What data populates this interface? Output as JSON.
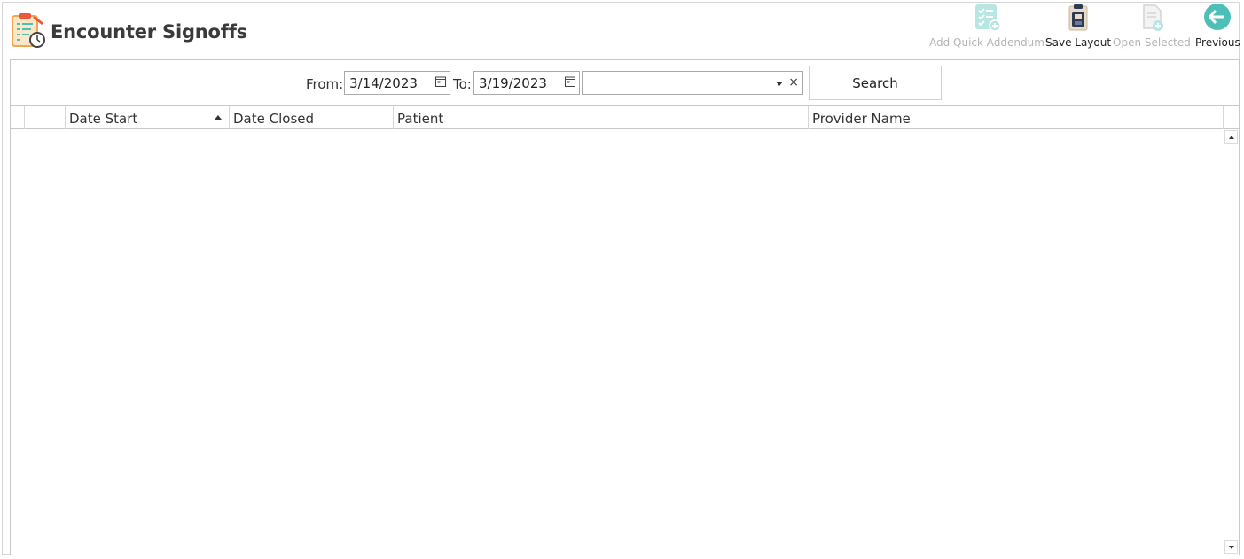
{
  "header": {
    "title": "Encounter Signoffs",
    "app_icon": "clipboard-clock-icon"
  },
  "toolbar": {
    "add_quick_addendum": {
      "label": "Add Quick Addendum",
      "icon": "checklist-add-icon",
      "enabled": false
    },
    "save_layout": {
      "label": "Save Layout",
      "icon": "save-clipboard-icon",
      "enabled": true
    },
    "open_selected": {
      "label": "Open Selected",
      "icon": "document-add-icon",
      "enabled": false
    },
    "previous": {
      "label": "Previous",
      "icon": "arrow-left-circle-icon",
      "enabled": true
    }
  },
  "filters": {
    "from_label": "From:",
    "from_date": "3/14/2023",
    "to_label": "To:",
    "to_date": "3/19/2023",
    "provider_value": "",
    "clear_glyph": "×",
    "search_label": "Search"
  },
  "grid": {
    "columns": [
      "",
      "",
      "Date Start",
      "Date Closed",
      "Patient",
      "Provider Name"
    ],
    "sorted_column": "Date Start",
    "sort_direction": "ascending",
    "rows": []
  },
  "colors": {
    "accent_teal": "#4dbfb8",
    "disabled_text": "#b4b4b4",
    "border": "#c8c8c8"
  }
}
